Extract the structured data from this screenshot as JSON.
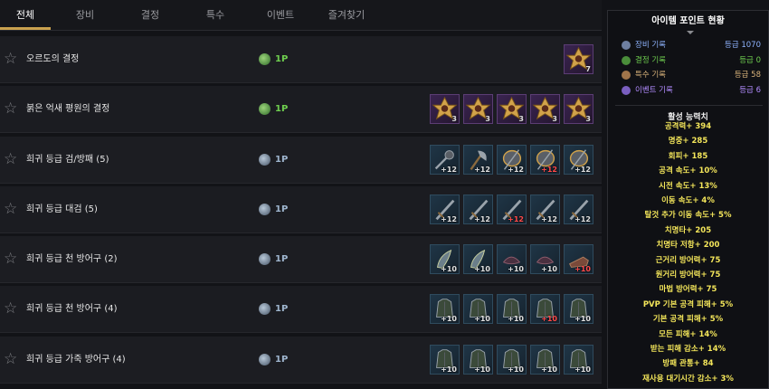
{
  "tabs": [
    {
      "label": "전체",
      "active": true
    },
    {
      "label": "장비"
    },
    {
      "label": "결정"
    },
    {
      "label": "특수"
    },
    {
      "label": "이벤트"
    },
    {
      "label": "즐겨찾기"
    }
  ],
  "rows": [
    {
      "name": "오르도의 결정",
      "points": "1P",
      "points_color": "green",
      "items": [
        {
          "icon": "gold-emblem-icon",
          "tier": "purple",
          "badge": "7"
        }
      ]
    },
    {
      "name": "붉은 억새 평원의 결정",
      "points": "1P",
      "points_color": "green",
      "items": [
        {
          "icon": "gold-emblem-icon",
          "tier": "purple",
          "badge": "3"
        },
        {
          "icon": "gold-emblem-icon",
          "tier": "purple",
          "badge": "3"
        },
        {
          "icon": "gold-emblem-icon",
          "tier": "purple",
          "badge": "3"
        },
        {
          "icon": "gold-emblem-icon",
          "tier": "purple",
          "badge": "3"
        },
        {
          "icon": "gold-emblem-icon",
          "tier": "purple",
          "badge": "3"
        }
      ]
    },
    {
      "name": "희귀 등급 검/방패 (5)",
      "points": "1P",
      "points_color": "blue",
      "items": [
        {
          "icon": "mace-icon",
          "tier": "blue",
          "badge": "+12"
        },
        {
          "icon": "axe-icon",
          "tier": "blue",
          "badge": "+12"
        },
        {
          "icon": "shield-icon",
          "tier": "blue",
          "badge": "+12"
        },
        {
          "icon": "shield-icon",
          "tier": "blue",
          "badge": "+12",
          "badge_red": true
        },
        {
          "icon": "shield-icon",
          "tier": "blue",
          "badge": "+12"
        }
      ]
    },
    {
      "name": "희귀 등급 대검 (5)",
      "points": "1P",
      "points_color": "blue",
      "items": [
        {
          "icon": "greatsword-icon",
          "tier": "blue",
          "badge": "+12"
        },
        {
          "icon": "greatsword-icon",
          "tier": "blue",
          "badge": "+12"
        },
        {
          "icon": "greatsword-icon",
          "tier": "blue",
          "badge": "+12",
          "badge_red": true
        },
        {
          "icon": "greatsword-icon",
          "tier": "blue",
          "badge": "+12"
        },
        {
          "icon": "greatsword-icon",
          "tier": "blue",
          "badge": "+12"
        }
      ]
    },
    {
      "name": "희귀 등급 천 방어구 (2)",
      "points": "1P",
      "points_color": "blue",
      "items": [
        {
          "icon": "gloves-icon",
          "tier": "blue",
          "badge": "+10"
        },
        {
          "icon": "gloves-icon",
          "tier": "blue",
          "badge": "+10"
        },
        {
          "icon": "hat-icon",
          "tier": "blue",
          "badge": "+10"
        },
        {
          "icon": "hat-icon",
          "tier": "blue",
          "badge": "+10"
        },
        {
          "icon": "boots-icon",
          "tier": "blue",
          "badge": "+10",
          "badge_red": true
        }
      ]
    },
    {
      "name": "희귀 등급 천 방어구 (4)",
      "points": "1P",
      "points_color": "blue",
      "items": [
        {
          "icon": "armor-icon",
          "tier": "blue",
          "badge": "+10"
        },
        {
          "icon": "armor-icon",
          "tier": "blue",
          "badge": "+10"
        },
        {
          "icon": "armor-icon",
          "tier": "blue",
          "badge": "+10"
        },
        {
          "icon": "armor-icon",
          "tier": "blue",
          "badge": "+10",
          "badge_red": true
        },
        {
          "icon": "armor-icon",
          "tier": "blue",
          "badge": "+10"
        }
      ]
    },
    {
      "name": "희귀 등급 가죽 방어구 (4)",
      "points": "1P",
      "points_color": "blue",
      "items": [
        {
          "icon": "armor-icon",
          "tier": "blue",
          "badge": "+10"
        },
        {
          "icon": "armor-icon",
          "tier": "blue",
          "badge": "+10"
        },
        {
          "icon": "armor-icon",
          "tier": "blue",
          "badge": "+10"
        },
        {
          "icon": "armor-icon",
          "tier": "blue",
          "badge": "+10"
        },
        {
          "icon": "armor-icon",
          "tier": "blue",
          "badge": "+10"
        }
      ]
    }
  ],
  "panel": {
    "title": "아이템 포인트 현황",
    "records": [
      {
        "label": "장비 기록",
        "value": "등급 1070",
        "color": "#8fb4ff",
        "dot": "#6e7fa0"
      },
      {
        "label": "결정 기록",
        "value": "등급 0",
        "color": "#6fcf4f",
        "dot": "#4a8d3a"
      },
      {
        "label": "특수 기록",
        "value": "등급 58",
        "color": "#d8b27a",
        "dot": "#a0744a"
      },
      {
        "label": "이벤트 기록",
        "value": "등급 6",
        "color": "#b28cff",
        "dot": "#7a5fc0"
      }
    ],
    "stats_title": "활성 능력치",
    "stats": [
      "공격력+ 394",
      "명중+ 285",
      "회피+ 185",
      "공격 속도+ 10%",
      "시전 속도+ 13%",
      "이동 속도+ 4%",
      "탈것 추가 이동 속도+ 5%",
      "치명타+ 205",
      "치명타 저항+ 200",
      "근거리 방어력+ 75",
      "원거리 방어력+ 75",
      "마법 방어력+ 75",
      "PVP 기본 공격 피해+ 5%",
      "기본 공격 피해+ 5%",
      "모든 피해+ 14%",
      "받는 피해 감소+ 14%",
      "방패 관통+ 84",
      "재사용 대기시간 감소+ 3%"
    ]
  }
}
